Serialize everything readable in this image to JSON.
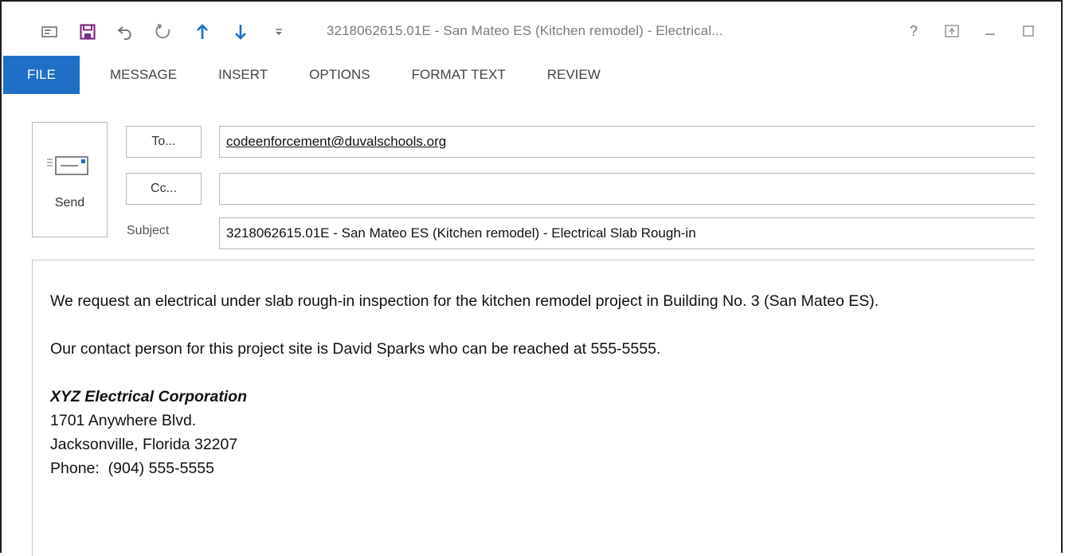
{
  "window": {
    "title": "3218062615.01E - San Mateo ES (Kitchen remodel) - Electrical...",
    "help_glyph": "?"
  },
  "ribbon": {
    "tabs": [
      "FILE",
      "MESSAGE",
      "INSERT",
      "OPTIONS",
      "FORMAT TEXT",
      "REVIEW"
    ]
  },
  "compose": {
    "send_label": "Send",
    "to_button": "To...",
    "cc_button": "Cc...",
    "subject_label": "Subject",
    "to_value": "codeenforcement@duvalschools.org",
    "cc_value": "",
    "subject_value": "3218062615.01E - San Mateo ES (Kitchen remodel) - Electrical Slab Rough-in"
  },
  "body": {
    "paragraph1": "We request an electrical under slab rough-in inspection for the kitchen remodel project in Building No. 3 (San Mateo ES).",
    "paragraph2": "Our contact person for this project site is David Sparks who can be reached at 555-5555.",
    "signature": {
      "company": "XYZ Electrical Corporation",
      "address1": "1701 Anywhere Blvd.",
      "address2": "Jacksonville, Florida 32207",
      "phone": "Phone:  (904) 555-5555"
    }
  },
  "colors": {
    "accent": "#1f6fc6",
    "save_icon": "#7b2a86",
    "arrow_icon": "#1f6fc6"
  }
}
